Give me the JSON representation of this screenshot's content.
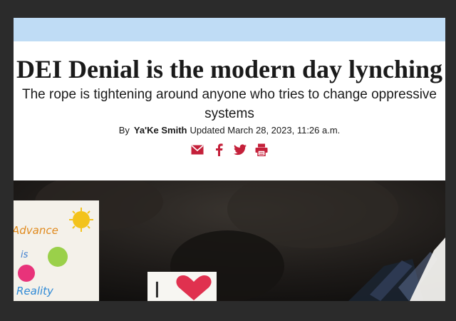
{
  "article": {
    "headline": "DEI Denial is the modern day lynching",
    "subheadline": "The rope is tightening around anyone who tries to change oppressive systems",
    "byline": {
      "prefix": "By",
      "author": "Ya'Ke Smith",
      "updated": "Updated March 28, 2023, 11:26 a.m."
    }
  },
  "share": {
    "icons": [
      "email-icon",
      "facebook-icon",
      "twitter-icon",
      "print-icon"
    ],
    "color": "#c4203a"
  },
  "hero_photo": {
    "sign_text": [
      "Advance",
      "is",
      "Reality"
    ],
    "sign_letter": "I"
  },
  "colors": {
    "banner": "#bfdcf5",
    "accent": "#c4203a",
    "backdrop": "#2b2b2b"
  }
}
